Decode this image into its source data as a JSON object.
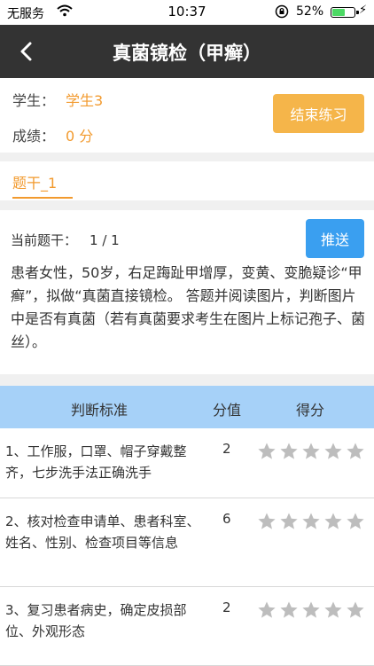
{
  "status_bar": {
    "carrier": "无服务",
    "time": "10:37",
    "battery_percent": "52%",
    "battery_level": 0.52
  },
  "nav": {
    "title": "真菌镜检（甲癣）"
  },
  "student": {
    "student_label": "学生：",
    "student_value": "学生3",
    "score_label": "成绩：",
    "score_value": "0 分",
    "end_button": "结束练习"
  },
  "tabs": [
    {
      "label": "题干_1",
      "active": true
    }
  ],
  "question": {
    "counter_label": "当前题干：",
    "counter_value": "1 / 1",
    "push_button": "推送",
    "text": "患者女性，50岁，右足踇趾甲增厚，变黄、变脆疑诊“甲癣”，拟做“真菌直接镜检。 答题并阅读图片，判断图片中是否有真菌（若有真菌要求考生在图片上标记孢子、菌丝）。"
  },
  "table": {
    "headers": {
      "criterion": "判断标准",
      "score": "分值",
      "earned": "得分"
    },
    "rows": [
      {
        "criterion": "1、工作服，口罩、帽子穿戴整齐，七步洗手法正确洗手",
        "score": "2",
        "stars_filled": 0,
        "stars_total": 5
      },
      {
        "criterion": "2、核对检查申请单、患者科室、姓名、性别、检查项目等信息",
        "score": "6",
        "stars_filled": 0,
        "stars_total": 5
      },
      {
        "criterion": "3、复习患者病史，确定皮损部位、外观形态",
        "score": "2",
        "stars_filled": 0,
        "stars_total": 5
      }
    ]
  },
  "colors": {
    "accent_orange": "#f29a2e",
    "end_button": "#f5b54a",
    "push_button": "#3a9ff0",
    "header_blue": "#a6d1f8",
    "nav_bg": "#333333",
    "star_empty": "#bdbdbd"
  }
}
